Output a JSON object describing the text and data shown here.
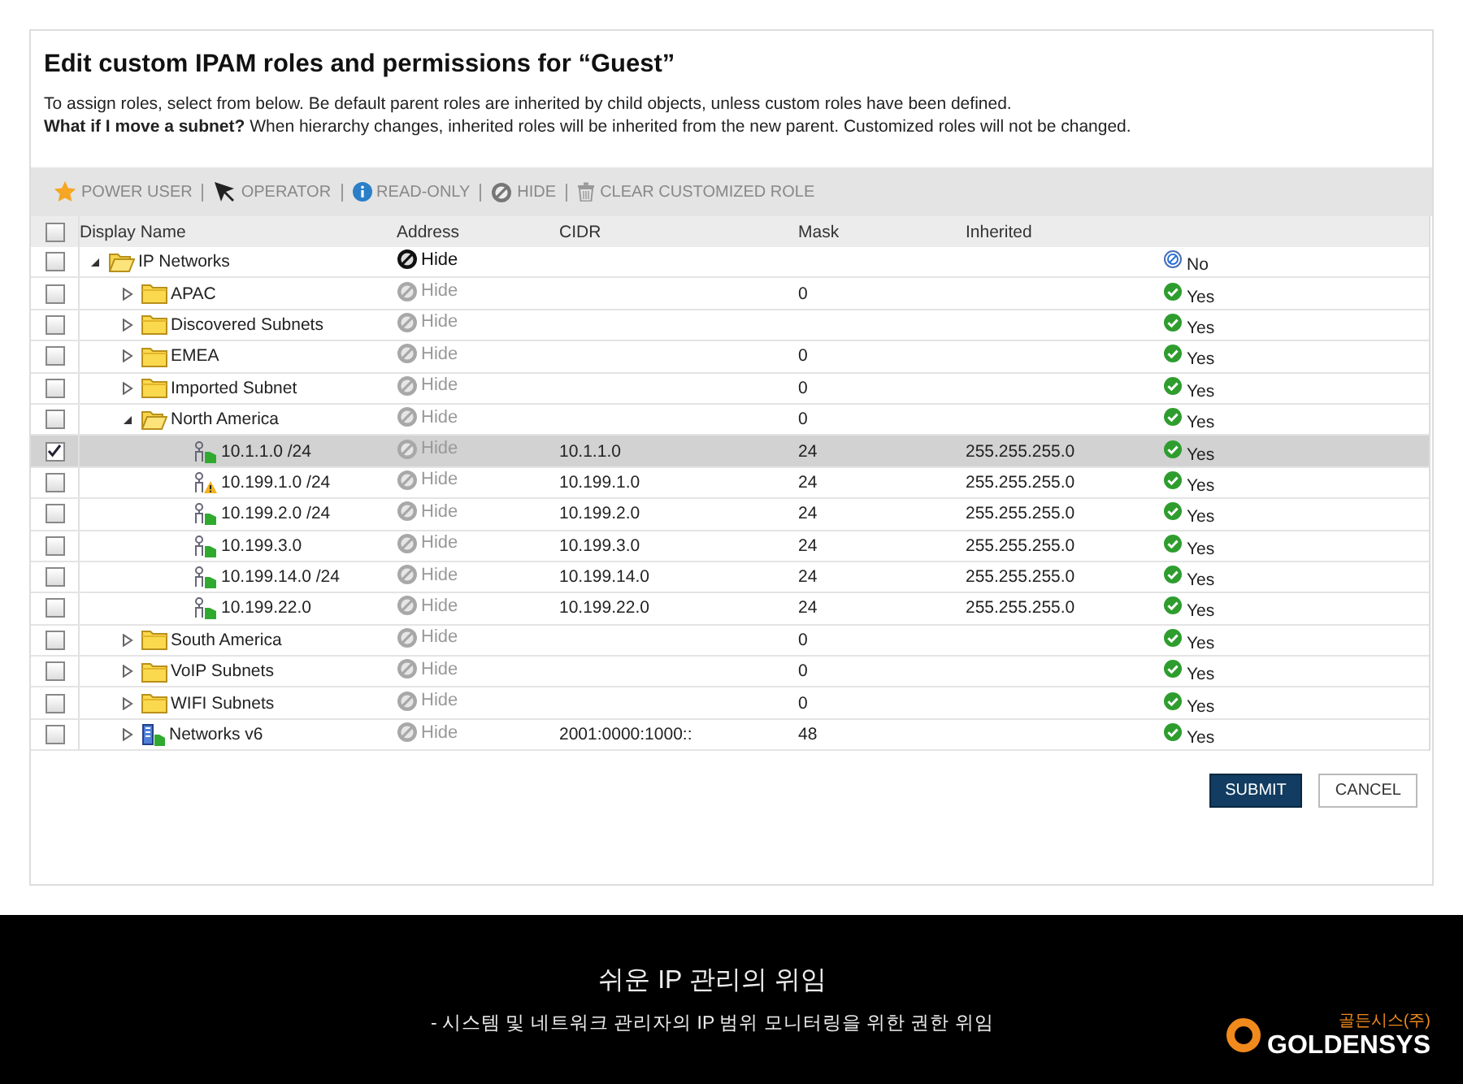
{
  "dialog": {
    "title": "Edit custom IPAM roles and permissions for “Guest”",
    "intro": "To assign roles, select from below. Be default parent roles are inherited by child objects, unless custom roles have been defined.",
    "note": "**What if I move a subnet?** When hierarchy changes, inherited roles will be inherited from the new parent. Customized roles will not be changed."
  },
  "toolbar": [
    {
      "kind": "star",
      "label": "POWER USER"
    },
    {
      "kind": "pointer",
      "label": "OPERATOR"
    },
    {
      "kind": "info",
      "label": "READ-ONLY"
    },
    {
      "kind": "hide",
      "label": "HIDE"
    },
    {
      "kind": "trash",
      "label": "CLEAR CUSTOMIZED ROLE"
    }
  ],
  "table": {
    "select_all": {
      "checked": false
    },
    "columns": [
      "Display Name",
      "Address",
      "CIDR",
      "Mask",
      "Inherited"
    ],
    "rows": [
      {
        "name": "IP Networks",
        "kind": "folder",
        "expanded": true,
        "checked": false,
        "selected": false,
        "address": "Hide",
        "explicit": true,
        "column_6": "No",
        "allowed": false,
        "children": [
          {
            "name": "APAC",
            "kind": "folder",
            "expanded": false,
            "checked": false,
            "selected": false,
            "address": "Hide",
            "explicit": false,
            "mask": "0",
            "column_6": "Yes",
            "allowed": true
          },
          {
            "name": "Discovered Subnets",
            "kind": "folder",
            "expanded": false,
            "checked": false,
            "selected": false,
            "address": "Hide",
            "explicit": false,
            "column_6": "Yes",
            "allowed": true
          },
          {
            "name": "EMEA",
            "kind": "folder",
            "expanded": false,
            "checked": false,
            "selected": false,
            "address": "Hide",
            "explicit": false,
            "mask": "0",
            "column_6": "Yes",
            "allowed": true
          },
          {
            "name": "Imported Subnet",
            "kind": "folder",
            "expanded": false,
            "checked": false,
            "selected": false,
            "address": "Hide",
            "explicit": false,
            "mask": "0",
            "column_6": "Yes",
            "allowed": true
          },
          {
            "name": "North America",
            "kind": "folder",
            "expanded": true,
            "checked": false,
            "selected": false,
            "address": "Hide",
            "explicit": false,
            "mask": "0",
            "column_6": "Yes",
            "allowed": true,
            "children": [
              {
                "name": "10.1.1.0 /24",
                "kind": "subnet",
                "checked": true,
                "selected": true,
                "address": "Hide",
                "explicit": false,
                "cidr": "10.1.1.0",
                "mask": "24",
                "inherited": "255.255.255.0",
                "column_6": "Yes",
                "allowed": true
              },
              {
                "name": "10.199.1.0 /24",
                "kind": "subnet-warning",
                "checked": false,
                "selected": false,
                "address": "Hide",
                "explicit": false,
                "cidr": "10.199.1.0",
                "mask": "24",
                "inherited": "255.255.255.0",
                "column_6": "Yes",
                "allowed": true
              },
              {
                "name": "10.199.2.0 /24",
                "kind": "subnet",
                "checked": false,
                "selected": false,
                "address": "Hide",
                "explicit": false,
                "cidr": "10.199.2.0",
                "mask": "24",
                "inherited": "255.255.255.0",
                "column_6": "Yes",
                "allowed": true
              },
              {
                "name": "10.199.3.0",
                "kind": "subnet",
                "checked": false,
                "selected": false,
                "address": "Hide",
                "explicit": false,
                "cidr": "10.199.3.0",
                "mask": "24",
                "inherited": "255.255.255.0",
                "column_6": "Yes",
                "allowed": true
              },
              {
                "name": "10.199.14.0 /24",
                "kind": "subnet",
                "checked": false,
                "selected": false,
                "address": "Hide",
                "explicit": false,
                "cidr": "10.199.14.0",
                "mask": "24",
                "inherited": "255.255.255.0",
                "column_6": "Yes",
                "allowed": true
              },
              {
                "name": "10.199.22.0",
                "kind": "subnet",
                "checked": false,
                "selected": false,
                "address": "Hide",
                "explicit": false,
                "cidr": "10.199.22.0",
                "mask": "24",
                "inherited": "255.255.255.0",
                "column_6": "Yes",
                "allowed": true
              }
            ]
          },
          {
            "name": "South America",
            "kind": "folder",
            "expanded": false,
            "checked": false,
            "selected": false,
            "address": "Hide",
            "explicit": false,
            "mask": "0",
            "column_6": "Yes",
            "allowed": true
          },
          {
            "name": "VoIP Subnets",
            "kind": "folder",
            "expanded": false,
            "checked": false,
            "selected": false,
            "address": "Hide",
            "explicit": false,
            "mask": "0",
            "column_6": "Yes",
            "allowed": true
          },
          {
            "name": "WIFI Subnets",
            "kind": "folder",
            "expanded": false,
            "checked": false,
            "selected": false,
            "address": "Hide",
            "explicit": false,
            "mask": "0",
            "column_6": "Yes",
            "allowed": true
          },
          {
            "name": "Networks v6",
            "kind": "ipv6",
            "expanded": false,
            "checked": false,
            "selected": false,
            "address": "Hide",
            "explicit": false,
            "cidr": "2001:0000:1000::",
            "mask": "48",
            "column_6": "Yes",
            "allowed": true
          }
        ]
      }
    ]
  },
  "buttons": [
    {
      "kind": "primary",
      "label": "SUBMIT"
    },
    {
      "kind": "secondary",
      "label": "CANCEL"
    }
  ],
  "banner": {
    "headline": "쉬운 IP 관리의 위임",
    "subline": "- 시스템 및 네트워크 관리자의 IP 범위 모니터링을 위한 권한 위임",
    "logo_small": "골든시스(주)",
    "logo": "GOLDENSYS"
  }
}
